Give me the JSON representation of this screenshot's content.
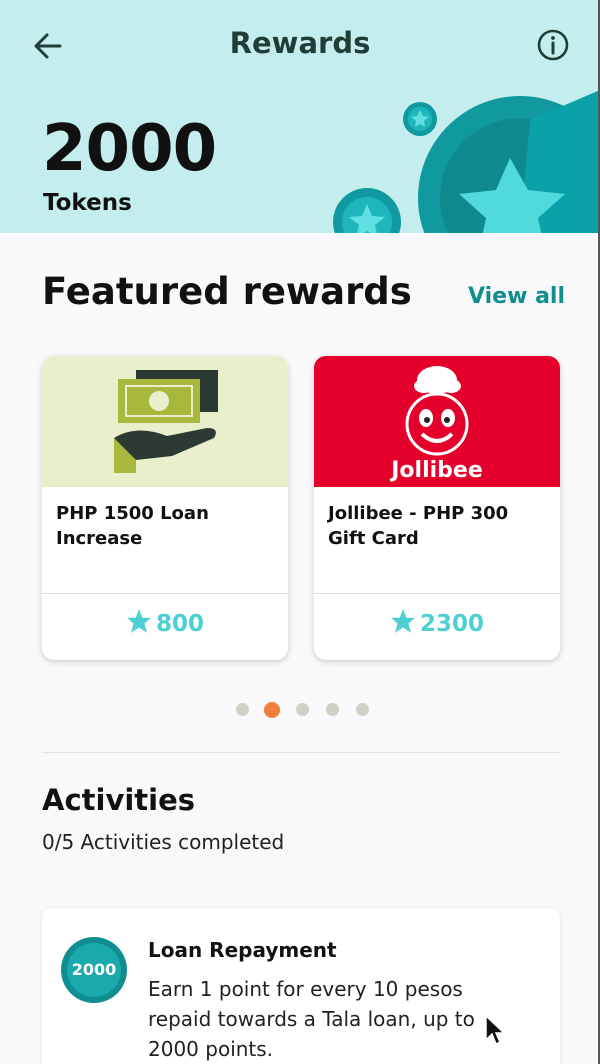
{
  "header": {
    "title": "Rewards",
    "back_icon": "arrow-left-icon",
    "info_icon": "info-circle-icon",
    "tokens_value": "2000",
    "tokens_label": "Tokens",
    "background": "#c4eeee"
  },
  "featured": {
    "title": "Featured rewards",
    "view_all": "View all",
    "cards": [
      {
        "title": "PHP 1500 Loan Increase",
        "price": "800",
        "image": "hand-with-cash-icon"
      },
      {
        "title": "Jollibee - PHP 300 Gift Card",
        "price": "2300",
        "image": "jollibee-logo",
        "logo_text": "Jollibee"
      }
    ],
    "pager": {
      "count": 5,
      "active_index": 1
    }
  },
  "activities": {
    "title": "Activities",
    "subtitle": "0/5 Activities completed",
    "items": [
      {
        "badge": "2000",
        "title": "Loan Repayment",
        "description": "Earn 1 point for every 10 pesos repaid towards a Tala loan, up to 2000 points."
      }
    ]
  },
  "colors": {
    "accent_teal": "#0f8d91",
    "star_teal": "#4dcfd4",
    "active_dot": "#ef7d3d",
    "jollibee_red": "#e4002b"
  }
}
